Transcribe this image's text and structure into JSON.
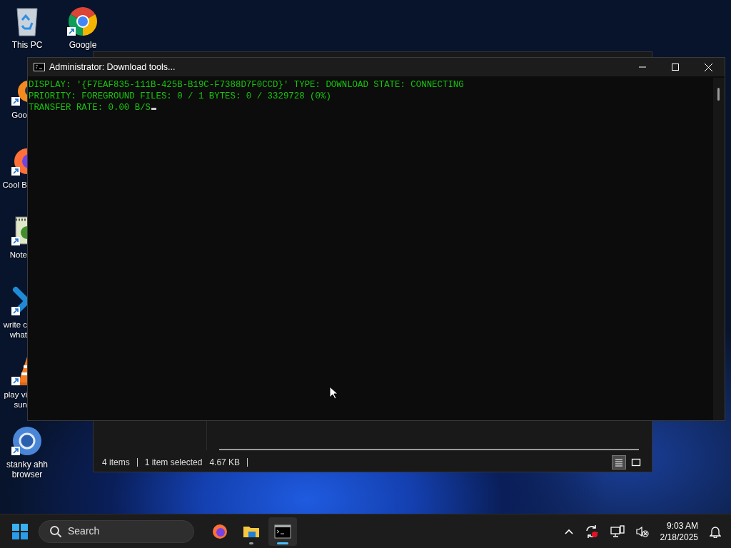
{
  "desktop_columns": [
    [
      {
        "kind": "bin",
        "lines": [
          "This PC"
        ],
        "shortcut": false,
        "clipped": false
      },
      {
        "kind": "blender",
        "lines": [
          "Goo"
        ],
        "shortcut": true,
        "clipped": true
      },
      {
        "kind": "firefox",
        "lines": [
          "Cool B"
        ],
        "shortcut": true,
        "clipped": true
      },
      {
        "kind": "notepad",
        "lines": [
          "Note"
        ],
        "shortcut": true,
        "clipped": true
      },
      {
        "kind": "cross",
        "lines": [
          "write c",
          "what"
        ],
        "shortcut": true,
        "clipped": true
      },
      {
        "kind": "cone",
        "lines": [
          "play vi",
          "sun"
        ],
        "shortcut": true,
        "clipped": true
      },
      {
        "kind": "chromium",
        "lines": [
          "stanky ahh",
          "browser"
        ],
        "shortcut": true,
        "clipped": false
      }
    ],
    [
      {
        "kind": "chrome",
        "lines": [
          "Google"
        ],
        "shortcut": true,
        "clipped": false
      }
    ]
  ],
  "explorer": {
    "status": [
      "4 items",
      "1 item selected",
      "4.67 KB"
    ],
    "views": [
      {
        "kind": "details",
        "selected": true
      },
      {
        "kind": "large-icons",
        "selected": false
      }
    ]
  },
  "console": {
    "title": "Administrator:  Download tools...",
    "lines": [
      "DISPLAY: '{F7EAF835-111B-425B-B19C-F7388D7F0CCD}' TYPE: DOWNLOAD STATE: CONNECTING",
      "PRIORITY: FOREGROUND FILES: 0 / 1 BYTES: 0 / 3329728 (0%)",
      "TRANSFER RATE: 0.00 B/S"
    ],
    "cursor": true
  },
  "taskbar": {
    "search_placeholder": "Search",
    "apps": [
      {
        "kind": "firefox",
        "running": false,
        "active": false
      },
      {
        "kind": "folder",
        "running": true,
        "active": false
      },
      {
        "kind": "console",
        "running": true,
        "active": true
      }
    ],
    "time": "9:03 AM",
    "date": "2/18/2025"
  }
}
